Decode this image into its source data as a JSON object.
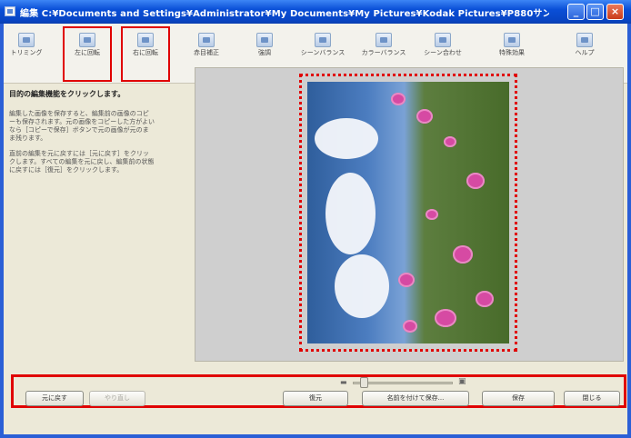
{
  "window": {
    "title": "編集 C:¥Documents and Settings¥Administrator¥My Documents¥My Pictures¥Kodak Pictures¥P880サン...",
    "controls": {
      "minimize": "_",
      "maximize": "□",
      "close": "×"
    }
  },
  "toolbar": {
    "items": [
      {
        "label": "トリミング",
        "icon": "crop-icon"
      },
      {
        "label": "左に回転",
        "icon": "rotate-left-icon"
      },
      {
        "label": "右に回転",
        "icon": "rotate-right-icon"
      },
      {
        "label": "赤目補正",
        "icon": "red-eye-icon"
      },
      {
        "label": "強調",
        "icon": "enhance-icon"
      },
      {
        "label": "シーンバランス",
        "icon": "scene-balance-icon"
      },
      {
        "label": "カラーバランス",
        "icon": "color-balance-icon"
      },
      {
        "label": "シーン合わせ",
        "icon": "scene-match-icon"
      },
      {
        "label": "特殊効果",
        "icon": "special-effects-icon"
      },
      {
        "label": "ヘルプ",
        "icon": "help-icon"
      }
    ]
  },
  "sidebar": {
    "heading": "目的の編集機能をクリックします。",
    "paragraph1": "編集した画像を保存すると、編集前の画像のコピーも保存されます。元の画像をコピーした方がよいなら［コピーで保存］ボタンで元の画像が元のまま残ります。",
    "paragraph2": "直前の編集を元に戻すには［元に戻す］をクリックします。すべての編集を元に戻し、編集前の状態に戻すには［復元］をクリックします。"
  },
  "footer": {
    "undo_label": "元に戻す",
    "redo_label": "やり直し",
    "restore_label": "復元",
    "save_as_label": "名前を付けて保存...",
    "save_label": "保存",
    "close_label": "閉じる"
  }
}
